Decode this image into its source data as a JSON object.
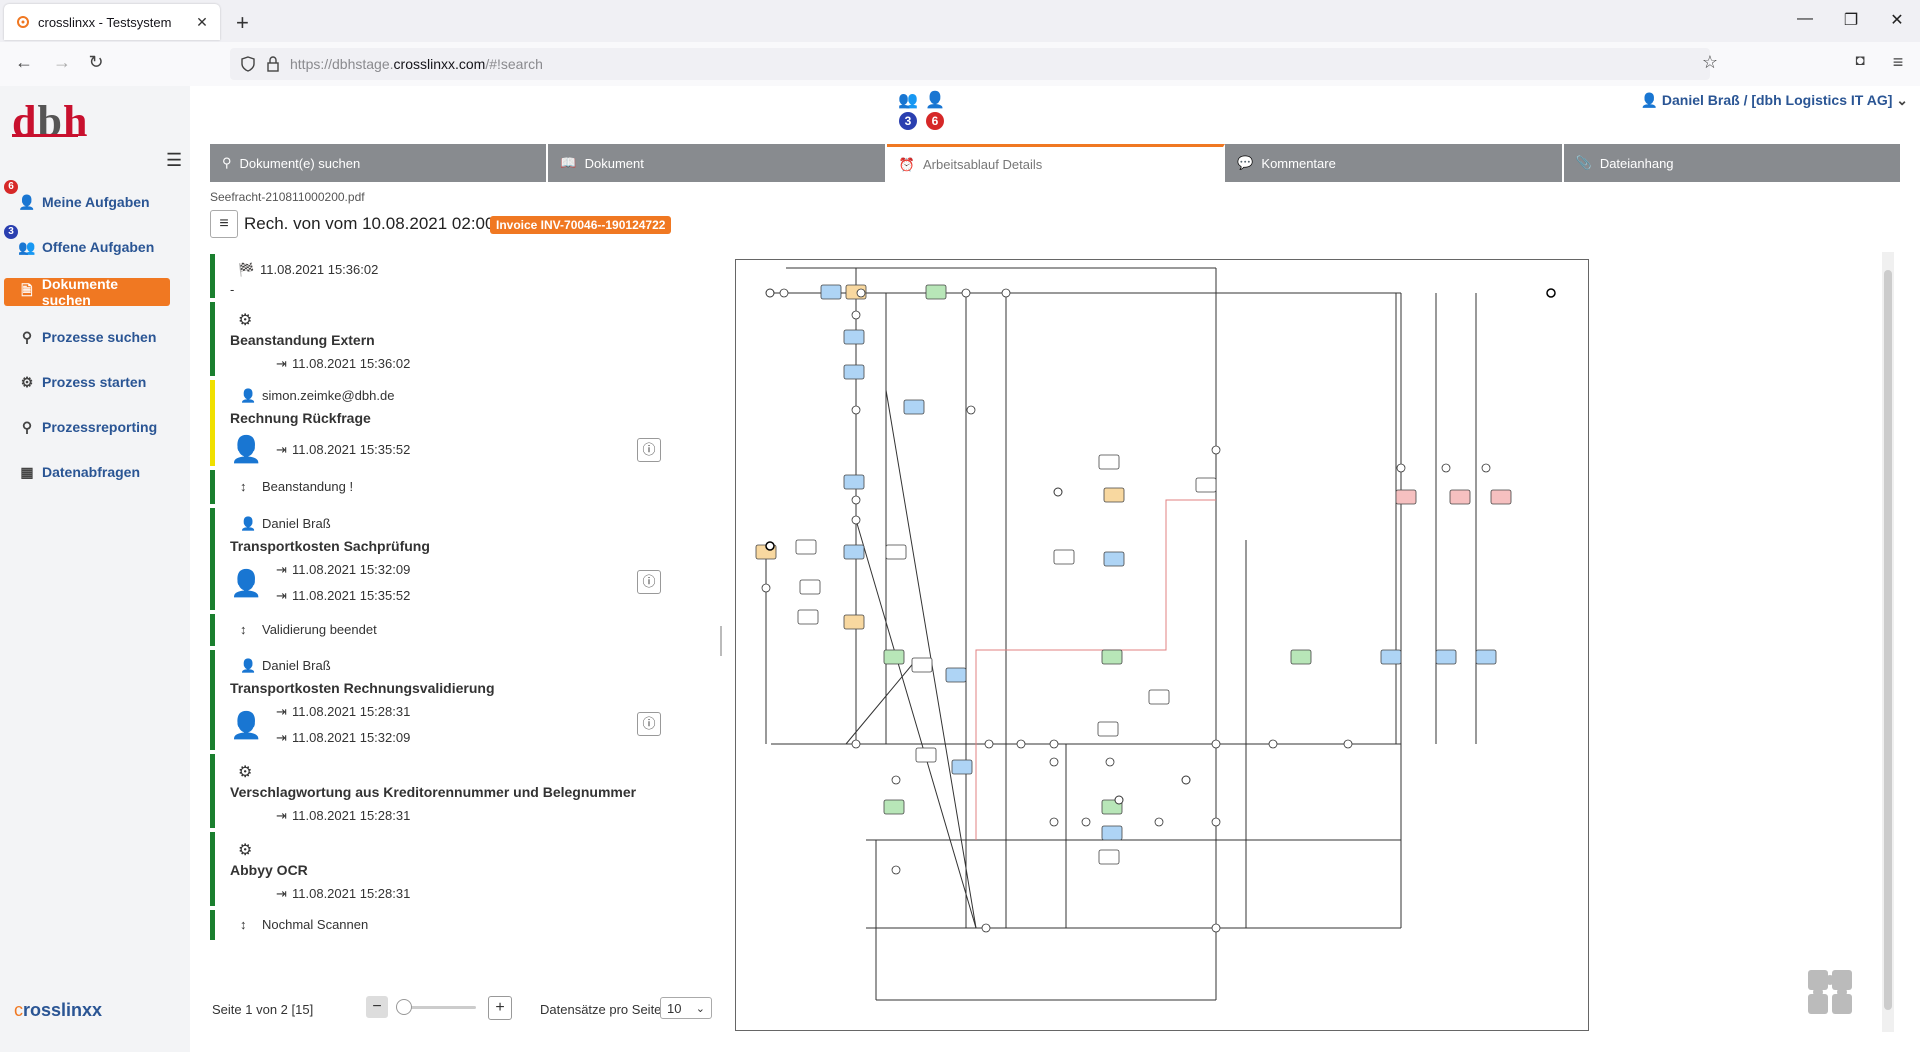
{
  "browser": {
    "tab_title": "crosslinxx - Testsystem",
    "url_prefix": "https://dbhstage.",
    "url_domain": "crosslinxx.com",
    "url_path": "/#!search"
  },
  "logo": {
    "d": "d",
    "b": "b",
    "h": "h"
  },
  "sidebar": {
    "items": [
      {
        "label": "Meine Aufgaben",
        "badge": "6"
      },
      {
        "label": "Offene Aufgaben",
        "badge": "3"
      },
      {
        "label": "Dokumente suchen"
      },
      {
        "label": "Prozesse suchen"
      },
      {
        "label": "Prozess starten"
      },
      {
        "label": "Prozessreporting"
      },
      {
        "label": "Datenabfragen"
      }
    ],
    "brand_c": "c",
    "brand_rest": "rosslinxx"
  },
  "counters": {
    "group_tasks": "3",
    "my_tasks": "6"
  },
  "user": {
    "name": "Daniel Braß / [dbh Logistics IT AG]"
  },
  "tabs": [
    {
      "label": "Dokument(e) suchen"
    },
    {
      "label": "Dokument"
    },
    {
      "label": "Arbeitsablauf Details"
    },
    {
      "label": "Kommentare"
    },
    {
      "label": "Dateianhang"
    }
  ],
  "document": {
    "filename": "Seefracht-210811000200.pdf",
    "title": "Rech. von vom 10.08.2021 02:00",
    "invoice": "Invoice INV-70046--190124722"
  },
  "timeline": [
    {
      "date": "11.08.2021 15:36:02",
      "sub": "-"
    },
    {
      "title": "Beanstandung Extern",
      "out": "11.08.2021 15:36:02"
    },
    {
      "user": "simon.zeimke@dbh.de",
      "title": "Rechnung Rückfrage",
      "in": "11.08.2021 15:35:52"
    },
    {
      "transition": "Beanstandung !"
    },
    {
      "user": "Daniel Braß",
      "title": "Transportkosten Sachprüfung",
      "in": "11.08.2021 15:32:09",
      "out": "11.08.2021 15:35:52"
    },
    {
      "transition": "Validierung beendet"
    },
    {
      "user": "Daniel Braß",
      "title": "Transportkosten Rechnungsvalidierung",
      "in": "11.08.2021 15:28:31",
      "out": "11.08.2021 15:32:09"
    },
    {
      "title": "Verschlagwortung aus Kreditorennummer und Belegnummer",
      "out": "11.08.2021 15:28:31"
    },
    {
      "title": "Abbyy OCR",
      "out": "11.08.2021 15:28:31"
    },
    {
      "transition": "Nochmal Scannen"
    }
  ],
  "pager": {
    "page_text": "Seite 1 von 2 [15]",
    "per_page_label": "Datensätze pro Seite",
    "per_page_value": "10"
  },
  "colors": {
    "accent": "#f07822",
    "link": "#2a5594",
    "brand_red": "#c8102e",
    "done_bar": "#1a7f2e",
    "active_bar": "#f0e000"
  }
}
